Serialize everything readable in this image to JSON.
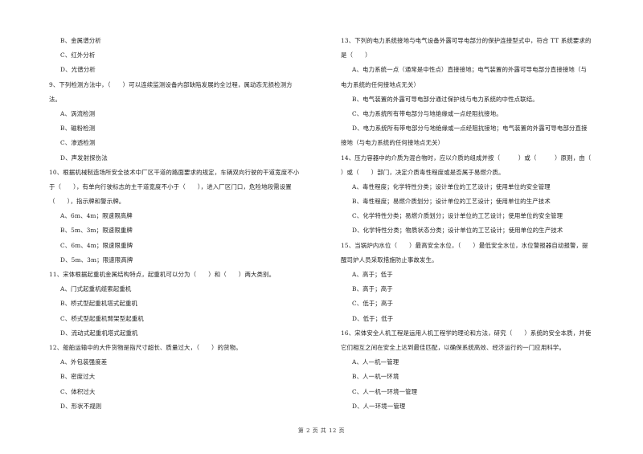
{
  "left_column": [
    {
      "type": "option",
      "text": "B、金属谱分析"
    },
    {
      "type": "option",
      "text": "C、红外分析"
    },
    {
      "type": "option",
      "text": "D、光谱分析"
    },
    {
      "type": "question",
      "text": "9、下列检测方法中，（　　）可以连续监测设备内部缺陷发展的全过程，属动态无损检测方"
    },
    {
      "type": "cont",
      "text": "法。"
    },
    {
      "type": "option",
      "text": "A、涡流检测"
    },
    {
      "type": "option",
      "text": "B、磁粉检测"
    },
    {
      "type": "option",
      "text": "C、渗透检测"
    },
    {
      "type": "option",
      "text": "D、声发射探伤法"
    },
    {
      "type": "question",
      "text": "10、根据机械制造场所安全技术中厂区干道的路面要求的规定，车辆双向行驶的干道宽度不小"
    },
    {
      "type": "cont",
      "text": "于（　　），有单向行驶标志的主干道宽度不小于（　　），进入厂区门口，危险地段需设置"
    },
    {
      "type": "cont",
      "text": "（　　），指示牌和警示牌。"
    },
    {
      "type": "option",
      "text": "A、6m、4m；限速限高牌"
    },
    {
      "type": "option",
      "text": "B、5m、3m；限速限重牌"
    },
    {
      "type": "option",
      "text": "C、6m、4m；限速限重牌"
    },
    {
      "type": "option",
      "text": "D、5m、3m；限速限高牌"
    },
    {
      "type": "question",
      "text": "11、宋体根据起重机金属结构特点，起重机可以分为（　　）和（　　）两大类别。"
    },
    {
      "type": "option",
      "text": "A、门式起重机缆索起重机"
    },
    {
      "type": "option",
      "text": "B、桥式型起重机塔式起重机"
    },
    {
      "type": "option",
      "text": "C、桥式型起重机臂架型起重机"
    },
    {
      "type": "option",
      "text": "D、流动式起重机塔式起重机"
    },
    {
      "type": "question",
      "text": "12、船舶运输中的大件货物是指尺寸超长、质量过大，（　　）的货物。"
    },
    {
      "type": "option",
      "text": "A、外包装强度差"
    },
    {
      "type": "option",
      "text": "B、密度过大"
    },
    {
      "type": "option",
      "text": "C、体积过大"
    },
    {
      "type": "option",
      "text": "D、形状不规则"
    }
  ],
  "right_column": [
    {
      "type": "question",
      "text": "13、下列的电力系统接地与电气设备外露可导电部分的保护连接型式中，符合 TT 系统要求的"
    },
    {
      "type": "cont",
      "text": "是（　　）"
    },
    {
      "type": "option",
      "text": "A、电力系统一点（通常是中性点）直接接地；电气装置的外露可导电部分直接接地（与"
    },
    {
      "type": "cont",
      "text": "电力系统的任何接地点无关）"
    },
    {
      "type": "option",
      "text": "B、电气装置的外露可导电部分通过保护线与电力系统的中性点联结。"
    },
    {
      "type": "option",
      "text": "C、电力系统所有带电部分与地绝缘或一点经阻抗接地。"
    },
    {
      "type": "option",
      "text": "D、电力系统所有带电部分与地绝缘或一点经阻抗接地；电气装置的外露可导电部分直接"
    },
    {
      "type": "cont",
      "text": "接地（与电力系统的任何接地点无关）"
    },
    {
      "type": "question",
      "text": "14、压力容器中的介质为混合物时，应以介质的组成并按（　　　）或（　　　）原则，由（"
    },
    {
      "type": "cont",
      "text": "）或（　　）部门，决定介质毒性程度或是否属于易燃介质。"
    },
    {
      "type": "option",
      "text": "A、毒性程度；化学特性分类；设计单位的工艺设计；使用单位的安全管理"
    },
    {
      "type": "option",
      "text": "B、毒性程度；易燃介质划分；设计单位的工艺设计；使用单位的生产技术"
    },
    {
      "type": "option",
      "text": "C、化学特性分类；易燃介质划分；设计单位的工艺设计；使用单位的安全管理"
    },
    {
      "type": "option",
      "text": "D、化学特性分类；物质状态分类；设计单位的工艺设计；使用单位的生产技术"
    },
    {
      "type": "question",
      "text": "15、当锅炉内水位（　　）最高安全水位，（　　）最低安全水位，水位警报器自动报警，提"
    },
    {
      "type": "cont",
      "text": "醒司炉人员采取措施防止事故发生。"
    },
    {
      "type": "option",
      "text": "A、高于；低于"
    },
    {
      "type": "option",
      "text": "B、高于；高于"
    },
    {
      "type": "option",
      "text": "C、低于；高于"
    },
    {
      "type": "option",
      "text": "D、低于；低于"
    },
    {
      "type": "question",
      "text": "16、宋体安全人机工程是运用人机工程学的理论和方法，研究（　　）系统的安全本质，并使"
    },
    {
      "type": "cont",
      "text": "它们相互之间在安全上达到最佳匹配，以确保系统高效、经济运行的一门应用科学。"
    },
    {
      "type": "option",
      "text": "A、人一机一管理"
    },
    {
      "type": "option",
      "text": "B、人一机一环境"
    },
    {
      "type": "option",
      "text": "C、人一机一环境一管理"
    },
    {
      "type": "option",
      "text": "D、人一环境一管理"
    }
  ],
  "footer": {
    "page_label": "第 2 页 共 12 页"
  }
}
